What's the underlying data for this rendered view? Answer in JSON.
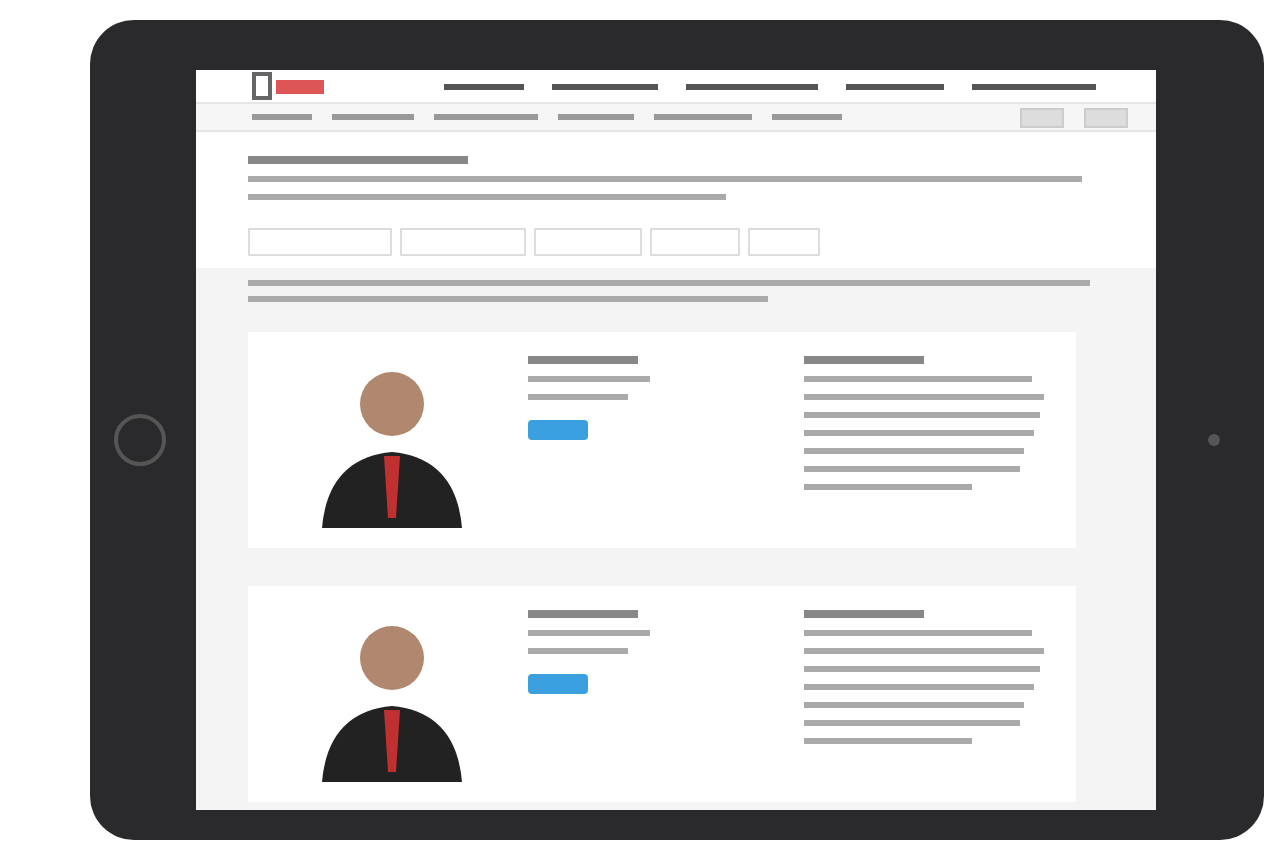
{
  "screen": {
    "nav_links": [
      {
        "kind": "link"
      },
      {
        "kind": "link"
      },
      {
        "kind": "link"
      },
      {
        "kind": "link"
      },
      {
        "kind": "link"
      }
    ],
    "toolbar_items": [
      {
        "kind": "item"
      },
      {
        "kind": "item"
      },
      {
        "kind": "item"
      },
      {
        "kind": "item"
      },
      {
        "kind": "item"
      },
      {
        "kind": "item"
      }
    ],
    "tabs": [
      {
        "selected": false
      },
      {
        "selected": false
      },
      {
        "selected": false
      },
      {
        "selected": false
      },
      {
        "selected": false
      }
    ],
    "profiles": [
      {
        "kind": "profile"
      },
      {
        "kind": "profile"
      }
    ]
  }
}
